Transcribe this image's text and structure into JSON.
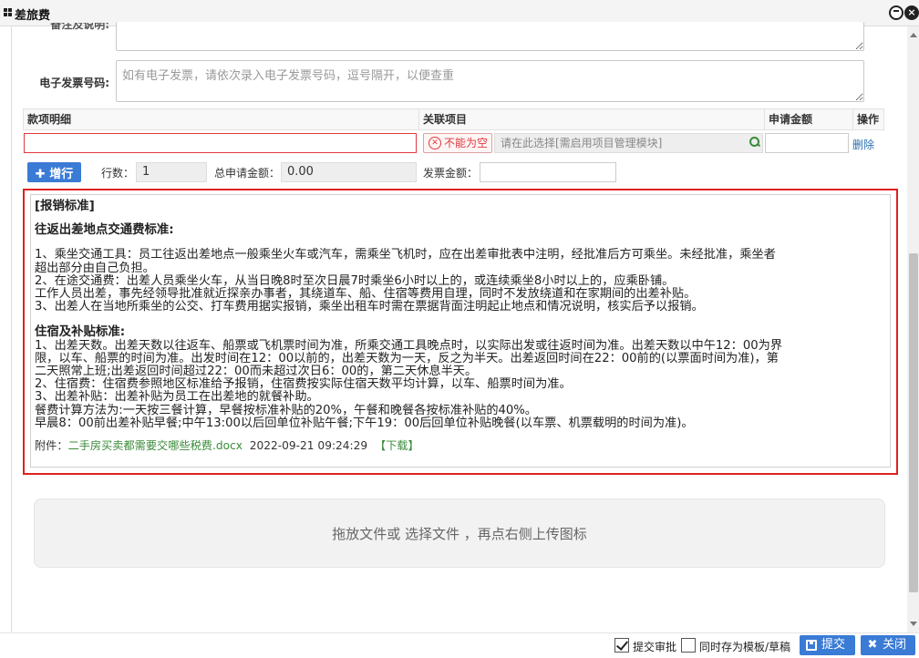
{
  "window": {
    "title": "差旅费"
  },
  "form": {
    "remark_label": "备注及说明:",
    "remark_value": "",
    "einvoice_label": "电子发票号码:",
    "einvoice_placeholder": "如有电子发票，请依次录入电子发票号码，逗号隔开，以便查重"
  },
  "table": {
    "headers": [
      "款项明细",
      "关联项目",
      "申请金额",
      "操作"
    ],
    "row": {
      "detail_value": "",
      "required_tip": "不能为空",
      "project_placeholder": "请在此选择[需启用项目管理模块]",
      "amount_value": "",
      "delete_label": "删除"
    }
  },
  "summary": {
    "add_row_label": "增行",
    "rows_label": "行数：",
    "rows_value": "1",
    "total_label": "总申请金额：",
    "total_value": "0.00",
    "invoice_label": "发票金额：",
    "invoice_value": ""
  },
  "standard": {
    "title": "[报销标准]",
    "section1_title": "往返出差地点交通费标准:",
    "section1_lines": [
      "1、乘坐交通工具：员工往返出差地点一般乘坐火车或汽车，需乘坐飞机时，应在出差审批表中注明，经批准后方可乘坐。未经批准，乘坐者",
      "超出部分由自己负担。",
      "2、在途交通费：出差人员乘坐火车，从当日晚8时至次日晨7时乘坐6小时以上的，或连续乘坐8小时以上的，应乘卧铺。",
      "工作人员出差，事先经领导批准就近探亲办事者，其绕道车、船、住宿等费用自理，同时不发放绕道和在家期间的出差补贴。",
      "3、出差人在当地所乘坐的公交、打车费用据实报销，乘坐出租车时需在票据背面注明起止地点和情况说明，核实后予以报销。"
    ],
    "section2_title": "住宿及补贴标准:",
    "section2_lines": [
      "1、出差天数。出差天数以往返车、船票或飞机票时间为准，所乘交通工具晚点时，以实际出发或往返时间为准。出差天数以中午12：00为界",
      "限，以车、船票的时间为准。出发时间在12：00以前的，出差天数为一天，反之为半天。出差返回时间在22：00前的(以票面时间为准)，第",
      "二天照常上班;出差返回时间超过22：00而未超过次日6：00的，第二天休息半天。",
      "2、住宿费：住宿费参照地区标准给予报销，住宿费按实际住宿天数平均计算，以车、船票时间为准。",
      "3、出差补贴：出差补贴为员工在出差地的就餐补助。",
      "餐费计算方法为:一天按三餐计算，早餐按标准补贴的20%，午餐和晚餐各按标准补贴的40%。",
      "早晨8：00前出差补贴早餐;中午13:00以后回单位补贴午餐;下午19：00后回单位补贴晚餐(以车票、机票载明的时间为准)。"
    ],
    "attachment_label": "附件：",
    "attachment_file": "二手房买卖都需要交哪些税费.docx",
    "attachment_time": "2022-09-21 09:24:29",
    "attachment_download": "【下载】"
  },
  "upload": {
    "hint": "拖放文件或 选择文件 ，再点右侧上传图标"
  },
  "footer": {
    "submit_approval_label": "提交审批",
    "submit_approval_checked": true,
    "save_template_label": "同时存为模板/草稿",
    "save_template_checked": false,
    "submit_button": "提交",
    "close_button": "关闭",
    "submit_color": "#3a7bd5",
    "close_color": "#3a7bd5"
  }
}
